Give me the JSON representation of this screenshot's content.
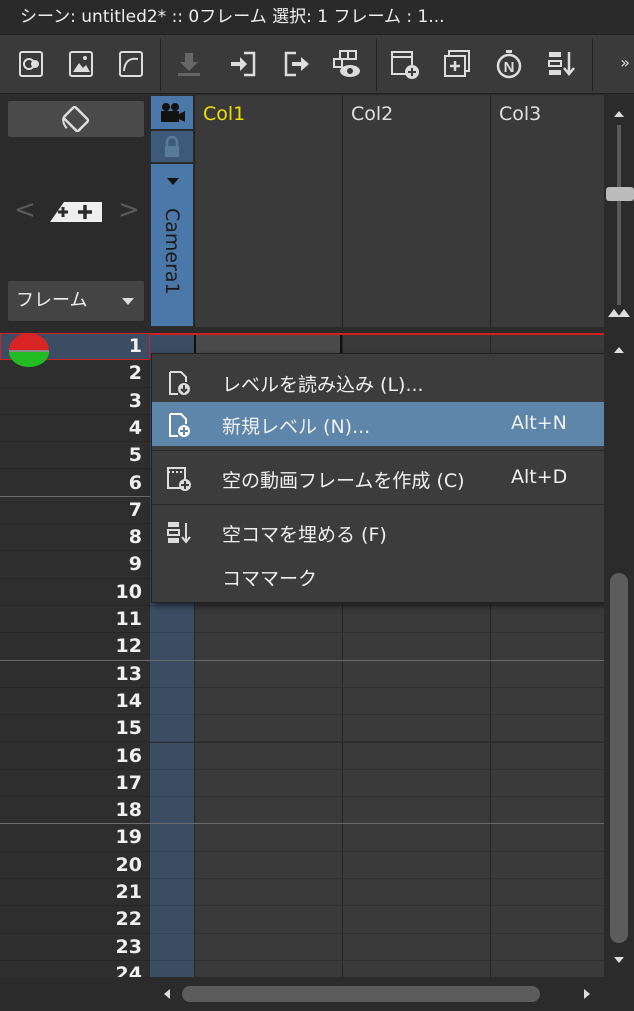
{
  "window": {
    "title": "シーン: untitled2*   ::   0フレーム   選択: 1 フレーム : 1..."
  },
  "toolbar": {
    "icons": [
      "scene-cast-icon",
      "image-icon",
      "shape-icon",
      "download-icon",
      "import-icon",
      "export-icon",
      "preview-icon",
      "new-frame-icon",
      "duplicate-icon",
      "timer-n-icon",
      "fill-empty-icon"
    ],
    "more": "»"
  },
  "left_panel": {
    "frame_select": "フレーム"
  },
  "camera": {
    "name": "Camera1"
  },
  "columns": [
    {
      "name": "Col1",
      "color": "#f0e000"
    },
    {
      "name": "Col2",
      "color": "#e0e0e0"
    },
    {
      "name": "Col3",
      "color": "#e0e0e0"
    }
  ],
  "rows": [
    "1",
    "2",
    "3",
    "4",
    "5",
    "6",
    "7",
    "8",
    "9",
    "10",
    "11",
    "12",
    "13",
    "14",
    "15",
    "16",
    "17",
    "18",
    "19",
    "20",
    "21",
    "22",
    "23",
    "24"
  ],
  "context_menu": {
    "items": [
      {
        "label": "レベルを読み込み (L)...",
        "shortcut": "",
        "icon": "load-level-icon",
        "highlight": false,
        "submenu": false
      },
      {
        "label": "新規レベル (N)...",
        "shortcut": "Alt+N",
        "icon": "new-level-icon",
        "highlight": true,
        "submenu": false
      },
      {
        "label": "空の動画フレームを作成 (C)",
        "shortcut": "Alt+D",
        "icon": "new-frame-icon",
        "highlight": false,
        "submenu": false
      },
      {
        "label": "空コマを埋める (F)",
        "shortcut": "",
        "icon": "fill-empty-icon",
        "highlight": false,
        "submenu": false
      },
      {
        "label": "コママーク",
        "shortcut": "",
        "icon": "",
        "highlight": false,
        "submenu": true
      }
    ]
  },
  "colors": {
    "accent": "#5e86ab",
    "camera_column": "#4a78a8",
    "selection": "#d02020"
  }
}
